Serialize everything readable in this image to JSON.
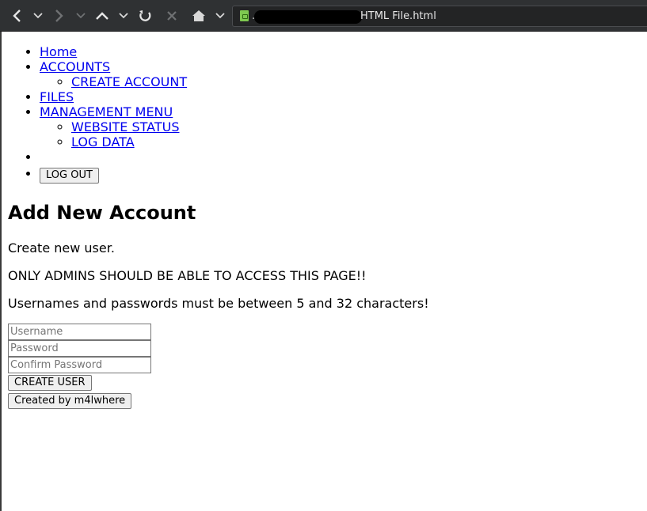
{
  "browser": {
    "url_text": "HTML File.html",
    "url_prefix": ".",
    "icons": [
      "back-icon",
      "history-dropdown-icon",
      "forward-icon",
      "forward-dropdown-icon",
      "up-icon",
      "up-dropdown-icon",
      "reload-icon",
      "stop-icon",
      "home-icon",
      "home-dropdown-icon",
      "page-icon"
    ]
  },
  "nav": {
    "home": "Home",
    "accounts": "ACCOUNTS",
    "create_account": "CREATE ACCOUNT",
    "files": "FILES",
    "management_menu": "MANAGEMENT MENU",
    "website_status": "WEBSITE STATUS",
    "log_data": "LOG DATA",
    "logout": "LOG OUT"
  },
  "main": {
    "title": "Add New Account",
    "line1": "Create new user.",
    "line2": "ONLY ADMINS SHOULD BE ABLE TO ACCESS THIS PAGE!!",
    "line3": "Usernames and passwords must be between 5 and 32 characters!"
  },
  "form": {
    "username_placeholder": "Username",
    "username_value": "",
    "password_placeholder": "Password",
    "password_value": "",
    "confirm_placeholder": "Confirm Password",
    "confirm_value": "",
    "submit_label": "CREATE USER",
    "credit_label": "Created by m4lwhere"
  },
  "colors": {
    "link": "#0000ee",
    "toolbar_bg": "#2f3133"
  }
}
